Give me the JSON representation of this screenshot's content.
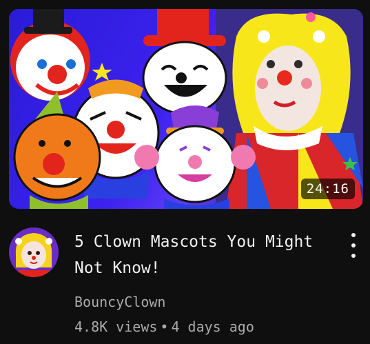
{
  "video": {
    "title": "5 Clown Mascots You Might Not Know!",
    "duration": "24:16",
    "channel": "BouncyClown",
    "views": "4.8K views",
    "separator": "•",
    "age": "4 days ago"
  },
  "icons": {
    "menu": "more-vert-icon"
  },
  "colors": {
    "background": "#0f0f0f",
    "title_text": "#f1f1f1",
    "meta_text": "#aaaaaa",
    "thumbnail_bg": "#3d22f0"
  }
}
